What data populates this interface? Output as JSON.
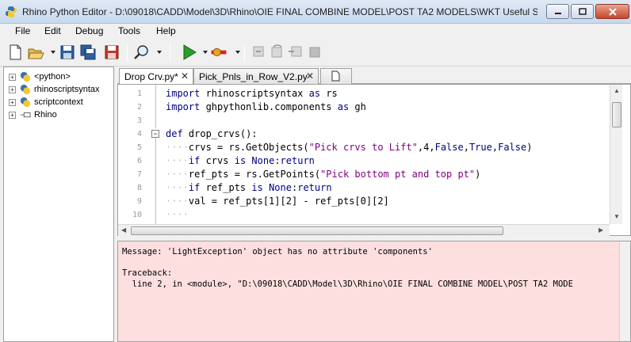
{
  "window": {
    "title": "Rhino Python Editor - D:\\09018\\CADD\\Model\\3D\\Rhino\\OIE FINAL COMBINE MODEL\\POST TA2 MODELS\\WKT Useful Scri..."
  },
  "menu": [
    "File",
    "Edit",
    "Debug",
    "Tools",
    "Help"
  ],
  "toolbar": {
    "icons": [
      "new-file-icon",
      "open-folder-icon",
      "save-icon",
      "save-all-icon",
      "save-as-icon",
      "search-icon",
      "run-icon",
      "record-icon",
      "step-into-icon",
      "step-over-icon",
      "step-out-icon",
      "stop-icon"
    ]
  },
  "tree": {
    "items": [
      "<python>",
      "rhinoscriptsyntax",
      "scriptcontext",
      "Rhino"
    ]
  },
  "tabs": [
    {
      "label": "Drop Crv.py*",
      "close": "✕"
    },
    {
      "label": "Pick_Pnls_in_Row_V2.py",
      "close": "✕"
    }
  ],
  "editor": {
    "line_numbers": [
      "1",
      "2",
      "3",
      "4",
      "5",
      "6",
      "7",
      "8",
      "9",
      "10"
    ]
  },
  "output": {
    "message": "Message: 'LightException' object has no attribute 'components'",
    "traceback_header": "Traceback:",
    "traceback_line": "  line 2, in <module>, \"D:\\09018\\CADD\\Model\\3D\\Rhino\\OIE FINAL COMBINE MODEL\\POST TA2 MODE"
  },
  "colors": {
    "keyword": "#00007f",
    "string": "#7f007f",
    "output_bg": "#fedfdf"
  }
}
